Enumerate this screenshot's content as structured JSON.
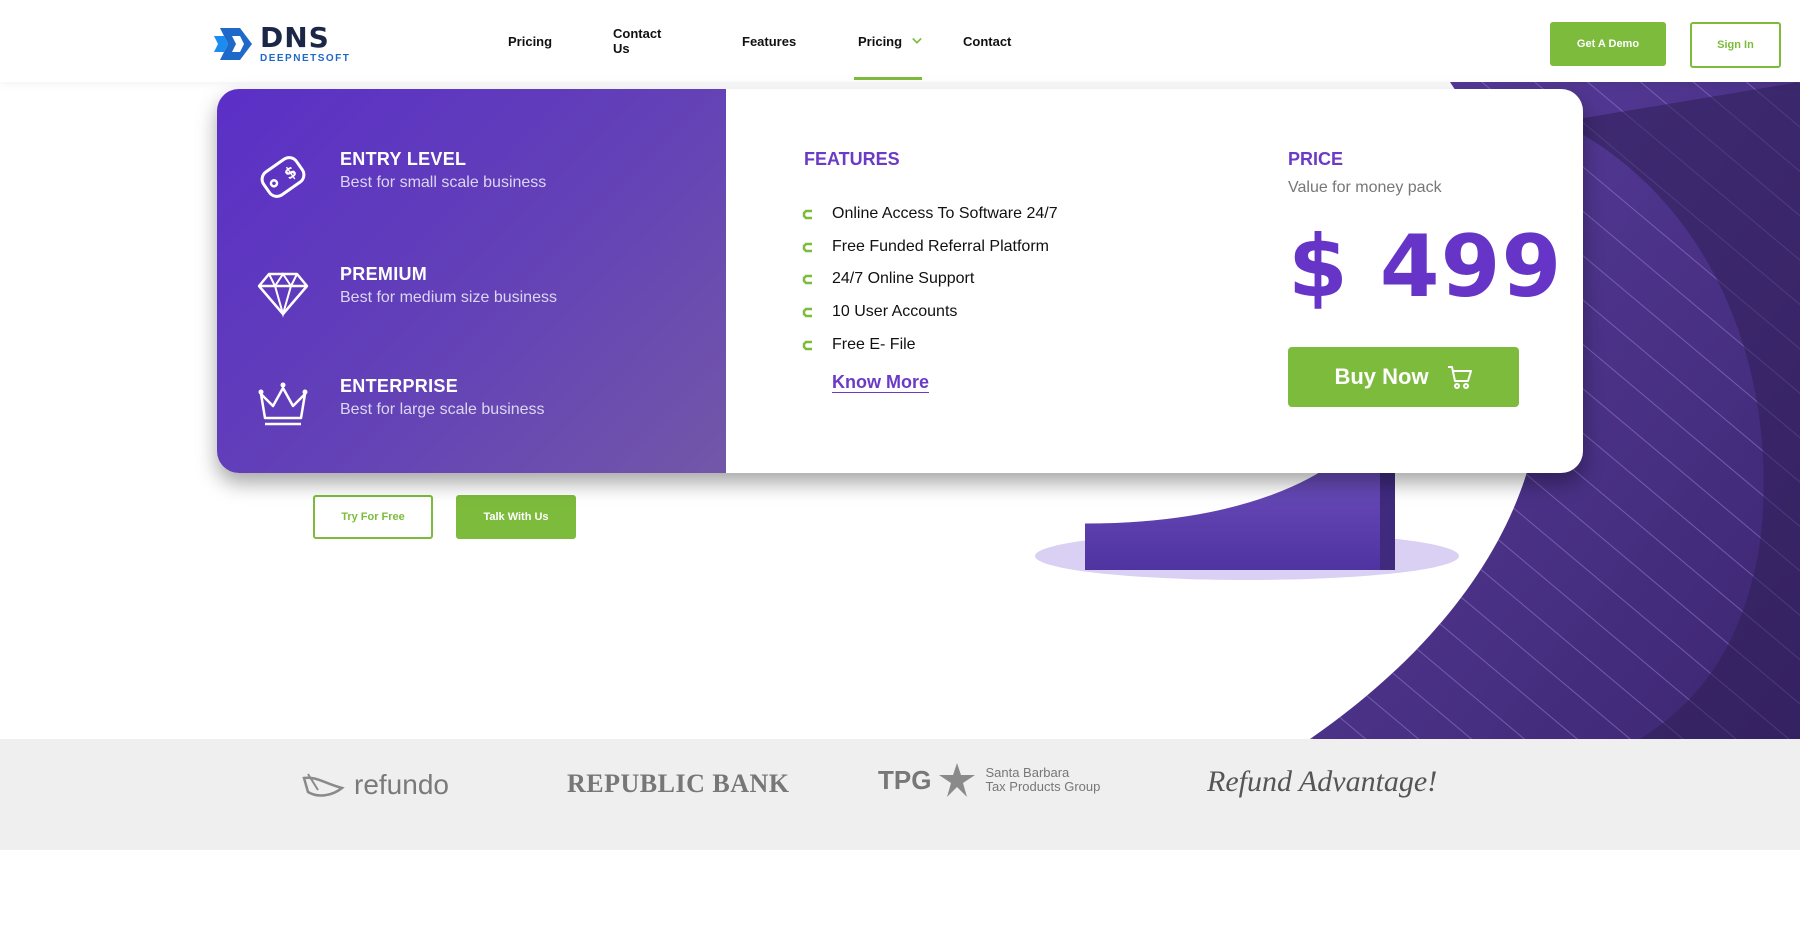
{
  "header": {
    "logo": {
      "main": "DNS",
      "sub": "DEEPNETSOFT"
    },
    "nav": [
      {
        "label": "Pricing"
      },
      {
        "label": "Contact Us"
      },
      {
        "label": "Features"
      },
      {
        "label": "Pricing",
        "active": true
      },
      {
        "label": "Contact"
      }
    ],
    "demo_label": "Get A Demo",
    "signin_label": "Sign In"
  },
  "hero": {
    "try_label": "Try For Free",
    "talk_label": "Talk With Us"
  },
  "dropdown": {
    "plans": [
      {
        "title": "ENTRY LEVEL",
        "subtitle": "Best for small scale business",
        "icon": "price-tag-icon"
      },
      {
        "title": "PREMIUM",
        "subtitle": "Best for medium size business",
        "icon": "diamond-icon"
      },
      {
        "title": "ENTERPRISE",
        "subtitle": "Best for large scale business",
        "icon": "crown-icon"
      }
    ],
    "features_title": "FEATURES",
    "features": [
      "Online Access To Software 24/7",
      "Free Funded Referral Platform",
      "24/7 Online Support",
      "10 User Accounts",
      "Free E- File"
    ],
    "know_more": "Know More",
    "price_title": "PRICE",
    "price_subtitle": "Value for money pack",
    "price": "$ 499",
    "buy_label": "Buy Now"
  },
  "partners": {
    "refundo": "refundo",
    "republic": "REPUBLIC BANK",
    "tpg": "TPG",
    "tpg_line1": "Santa Barbara",
    "tpg_line2": "Tax Products Group",
    "refund_advantage": "Refund Advantage!"
  },
  "colors": {
    "brand_green": "#7dbb3d",
    "brand_purple": "#6b3ac7",
    "logo_navy": "#1b2746",
    "logo_blue": "#1f69c8"
  }
}
